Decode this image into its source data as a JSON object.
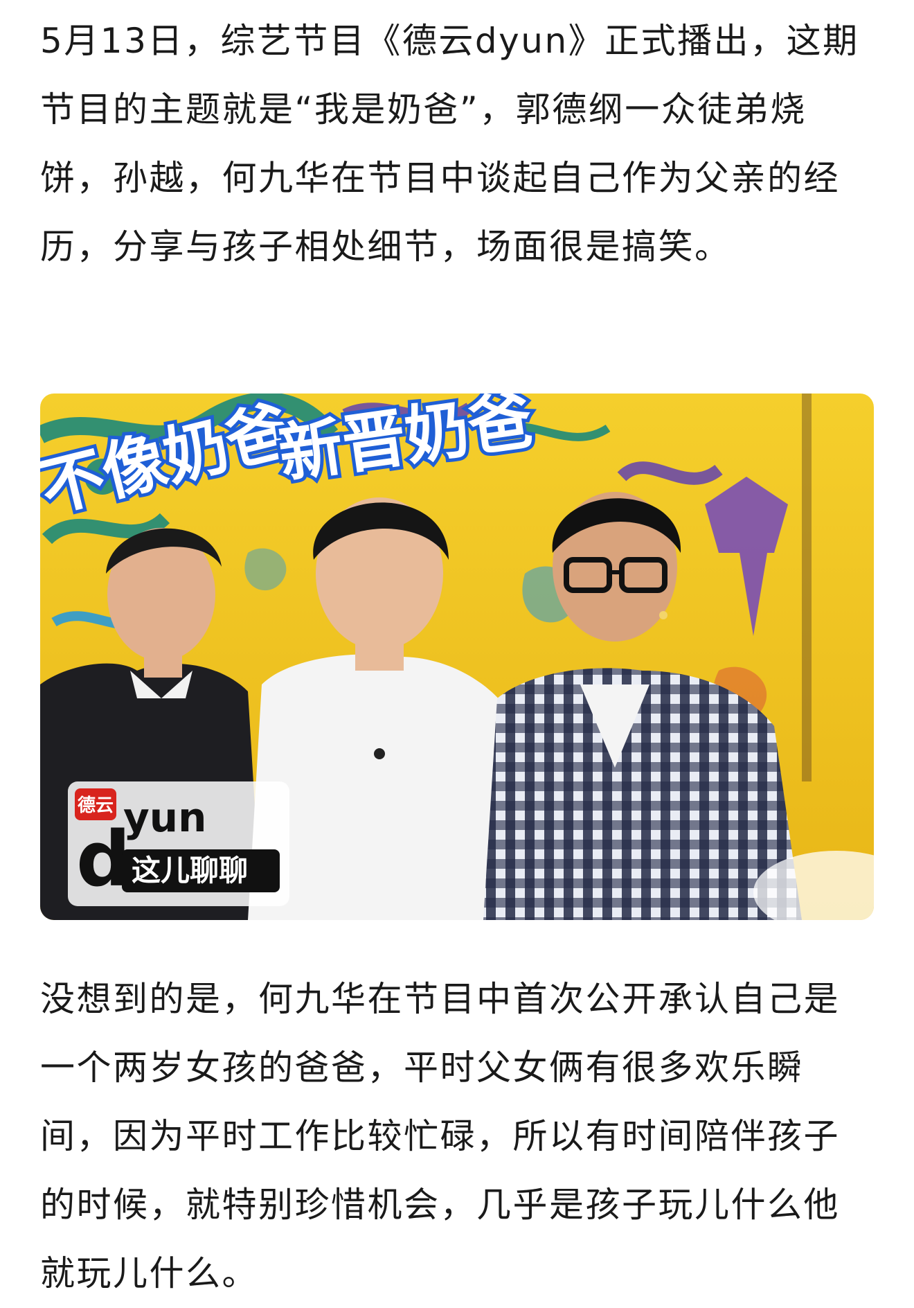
{
  "article": {
    "paragraph_1": "5月13日，综艺节目《德云dyun》正式播出，这期节目的主题就是“我是奶爸”，郭德纲一众徒弟烧饼，孙越，何九华在节目中谈起自己作为父亲的经历，分享与孩子相处细节，场面很是搞笑。",
    "paragraph_2": "没想到的是，何九华在节目中首次公开承认自己是一个两岁女孩的爸爸，平时父女俩有很多欢乐瞬间，因为平时工作比较忙碌，所以有时间陪伴孩子的时候，就特别珍惜机会，几乎是孩子玩儿什么他就玩儿什么。"
  },
  "image": {
    "caption_left": "不像奶爸",
    "caption_right": "新晋奶爸",
    "logo_badge": "德云",
    "logo_d": "d",
    "logo_yun": "yun",
    "logo_sub": "这儿聊聊"
  },
  "colors": {
    "text": "#1a1a1a",
    "background": "#ffffff",
    "backdrop_yellow": "#f2c623",
    "caption_blue": "#1f5fd6",
    "logo_red": "#d8241d"
  }
}
